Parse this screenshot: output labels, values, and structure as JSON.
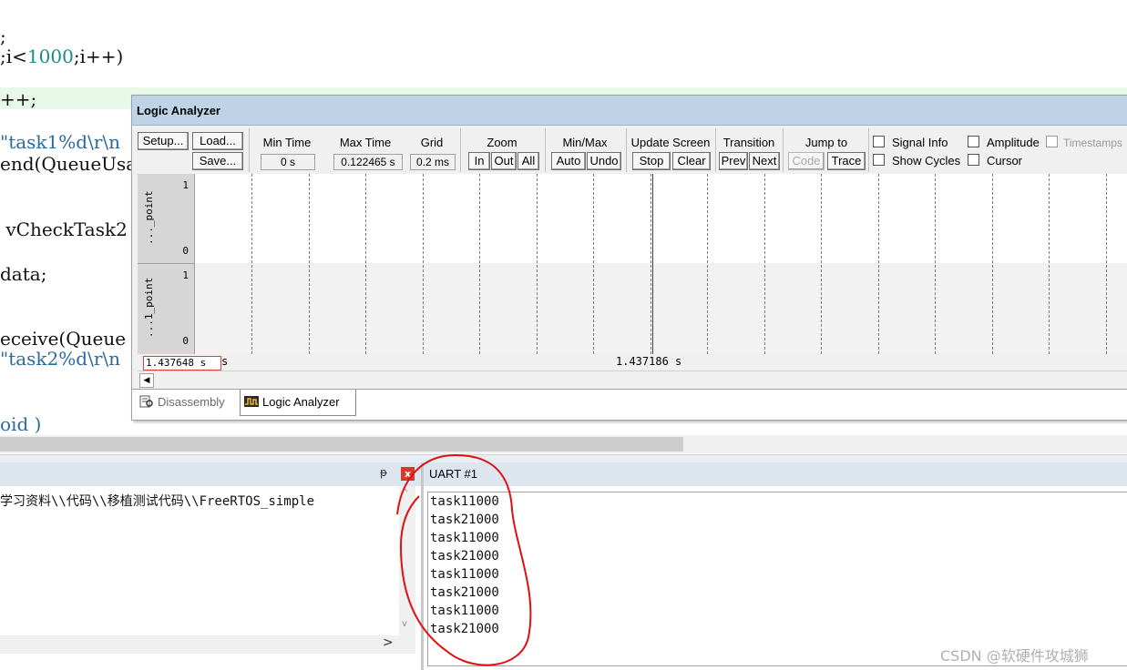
{
  "editor": {
    "lines": [
      {
        "parts": [
          {
            "t": ";",
            "c": ""
          }
        ]
      },
      {
        "parts": [
          {
            "t": ";i<",
            "c": ""
          },
          {
            "t": "1000",
            "c": "num"
          },
          {
            "t": ";i++)",
            "c": ""
          }
        ]
      },
      {
        "parts": [
          {
            "t": "++;",
            "c": ""
          }
        ]
      },
      {
        "parts": [
          {
            "t": "\"task1%d\\r\\n",
            "c": "str"
          }
        ]
      },
      {
        "parts": [
          {
            "t": "end(QueueUsa",
            "c": ""
          }
        ]
      },
      {
        "parts": [
          {
            "t": " vCheckTask2",
            "c": ""
          }
        ]
      },
      {
        "parts": [
          {
            "t": "data;",
            "c": ""
          }
        ]
      },
      {
        "parts": [
          {
            "t": "eceive(Queue",
            "c": ""
          }
        ]
      },
      {
        "parts": [
          {
            "t": "\"task2%d\\r\\n",
            "c": "str"
          }
        ]
      },
      {
        "parts": [
          {
            "t": "oid )",
            "c": "str"
          }
        ]
      }
    ]
  },
  "logic_analyzer": {
    "title": "Logic Analyzer",
    "buttons": {
      "setup": "Setup...",
      "load": "Load...",
      "save": "Save..."
    },
    "min_time": {
      "label": "Min Time",
      "value": "0 s"
    },
    "max_time": {
      "label": "Max Time",
      "value": "0.122465 s"
    },
    "grid": {
      "label": "Grid",
      "value": "0.2 ms"
    },
    "zoom": {
      "label": "Zoom",
      "in": "In",
      "out": "Out",
      "all": "All"
    },
    "minmax": {
      "label": "Min/Max",
      "auto": "Auto",
      "undo": "Undo"
    },
    "update_screen": {
      "label": "Update Screen",
      "stop": "Stop",
      "clear": "Clear"
    },
    "transition": {
      "label": "Transition",
      "prev": "Prev",
      "next": "Next"
    },
    "jump_to": {
      "label": "Jump to",
      "code": "Code",
      "trace": "Trace"
    },
    "options": {
      "signal_info": "Signal Info",
      "amplitude": "Amplitude",
      "timestamps": "Timestamps",
      "show_cycles": "Show Cycles",
      "cursor": "Cursor"
    },
    "signals": [
      {
        "name": "..._point",
        "max": "1",
        "min": "0"
      },
      {
        "name": "...1_point",
        "max": "1",
        "min": "0"
      }
    ],
    "time_box": "1.437648 s",
    "time_unit": "s",
    "time_center": "1.437186 s",
    "tabs": {
      "disassembly": "Disassembly",
      "logic_analyzer": "Logic Analyzer"
    }
  },
  "build_output": {
    "text": "学习资料\\\\代码\\\\移植测试代码\\\\FreeRTOS_simple",
    "pin": "ᵽ",
    "close": "x",
    "scroll_right": ">"
  },
  "uart": {
    "title": "UART #1",
    "lines": [
      "task11000",
      "task21000",
      "task11000",
      "task21000",
      "task11000",
      "task21000",
      "task11000",
      "task21000"
    ]
  },
  "watermark": "CSDN @软硬件攻城狮",
  "colors": {
    "annotation": "#e01010",
    "title_bar": "#bfd3e6"
  }
}
